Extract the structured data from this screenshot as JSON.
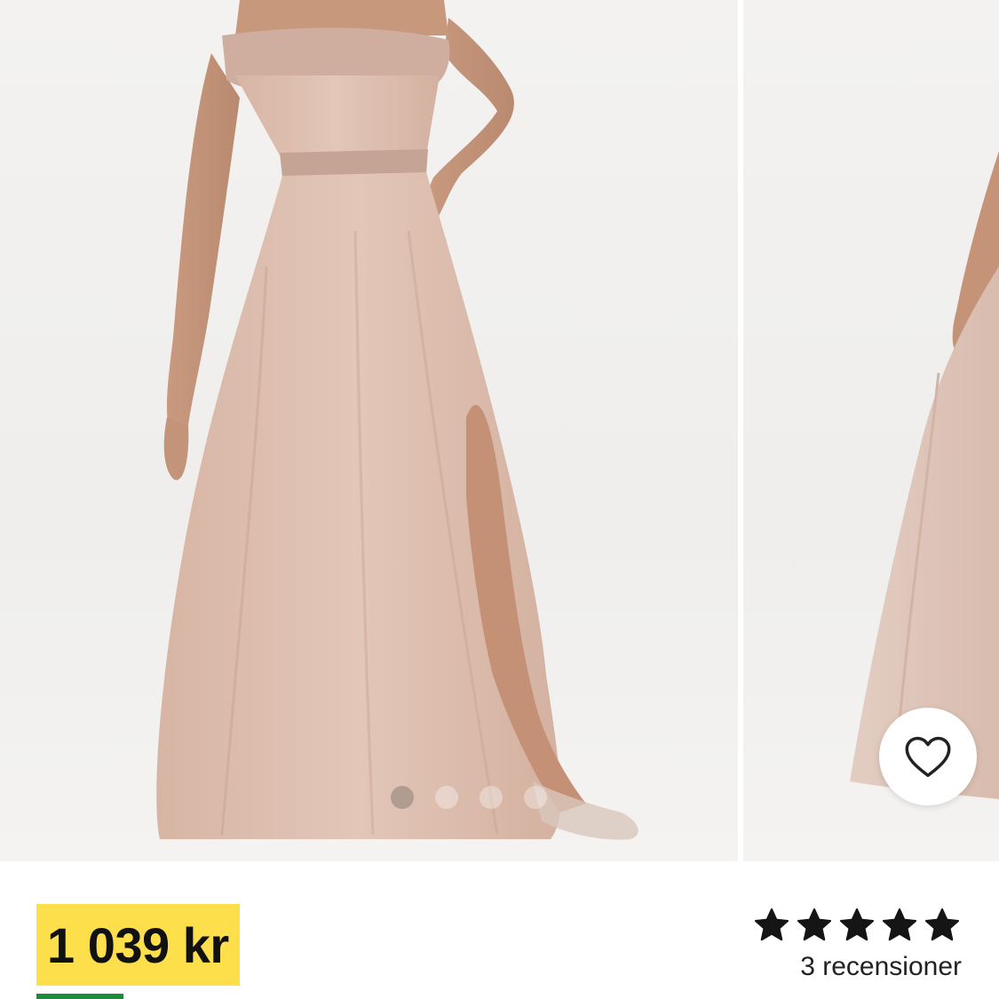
{
  "product": {
    "price": "1 039 kr",
    "rating_value": 5,
    "rating_max": 5,
    "review_count_text": "3 recensioner"
  },
  "gallery": {
    "image_count": 4,
    "active_index": 1,
    "images": [
      {
        "name": "dress-front-image"
      },
      {
        "name": "dress-side-image"
      }
    ]
  },
  "icons": {
    "favorite": "heart-outline-icon",
    "star": "star-icon"
  },
  "colors": {
    "price_highlight": "#fcdf4a",
    "accent_green": "#1e8a3c",
    "dress": "#dcbcac",
    "text": "#111111"
  }
}
